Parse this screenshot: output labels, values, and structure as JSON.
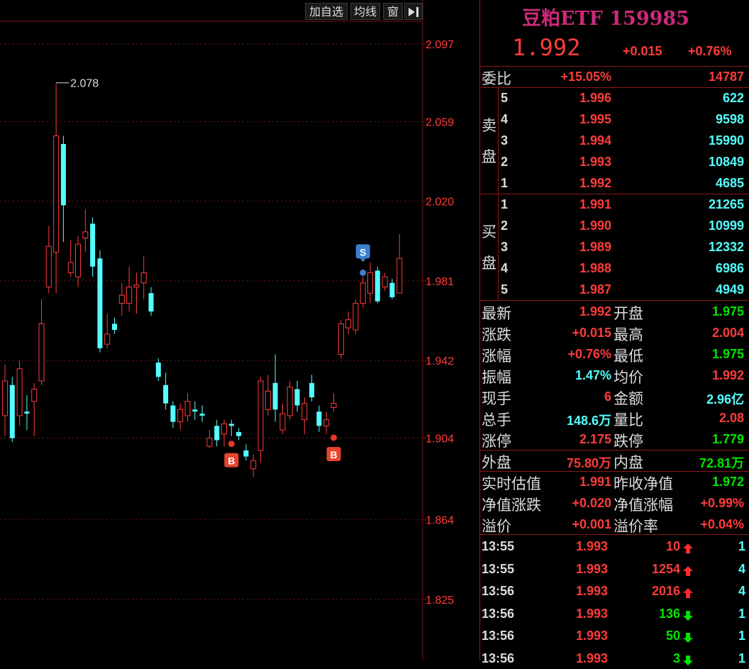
{
  "toolbar": {
    "add_watchlist": "加自选",
    "moving_avg": "均线",
    "window": "窗",
    "expand_icon": "arrow-right-bar-icon"
  },
  "chart_data": {
    "type": "candlestick",
    "title": "",
    "y_ticks": [
      "2.097",
      "2.059",
      "2.020",
      "1.981",
      "1.942",
      "1.904",
      "1.864",
      "1.825"
    ],
    "ylim": [
      1.79,
      2.12
    ],
    "peak_label": "2.078",
    "grid": true,
    "candles": [
      {
        "o": 1.915,
        "c": 1.932,
        "h": 1.94,
        "l": 1.905
      },
      {
        "o": 1.93,
        "c": 1.904,
        "h": 1.934,
        "l": 1.902
      },
      {
        "o": 1.915,
        "c": 1.938,
        "h": 1.942,
        "l": 1.91
      },
      {
        "o": 1.917,
        "c": 1.916,
        "h": 1.925,
        "l": 1.908
      },
      {
        "o": 1.922,
        "c": 1.928,
        "h": 1.931,
        "l": 1.905
      },
      {
        "o": 1.932,
        "c": 1.96,
        "h": 1.972,
        "l": 1.93
      },
      {
        "o": 1.978,
        "c": 1.998,
        "h": 2.008,
        "l": 1.975
      },
      {
        "o": 1.995,
        "c": 2.052,
        "h": 2.078,
        "l": 1.975
      },
      {
        "o": 2.048,
        "c": 2.018,
        "h": 2.052,
        "l": 2.0
      },
      {
        "o": 1.985,
        "c": 1.99,
        "h": 2.001,
        "l": 1.983
      },
      {
        "o": 1.983,
        "c": 1.999,
        "h": 2.003,
        "l": 1.978
      },
      {
        "o": 2.002,
        "c": 2.005,
        "h": 2.016,
        "l": 1.995
      },
      {
        "o": 2.009,
        "c": 1.988,
        "h": 2.012,
        "l": 1.983
      },
      {
        "o": 1.992,
        "c": 1.948,
        "h": 1.996,
        "l": 1.946
      },
      {
        "o": 1.95,
        "c": 1.955,
        "h": 1.965,
        "l": 1.948
      },
      {
        "o": 1.96,
        "c": 1.957,
        "h": 1.963,
        "l": 1.955
      },
      {
        "o": 1.97,
        "c": 1.974,
        "h": 1.98,
        "l": 1.964
      },
      {
        "o": 1.97,
        "c": 1.978,
        "h": 1.988,
        "l": 1.966
      },
      {
        "o": 1.978,
        "c": 1.979,
        "h": 1.985,
        "l": 1.965
      },
      {
        "o": 1.98,
        "c": 1.985,
        "h": 1.993,
        "l": 1.972
      },
      {
        "o": 1.975,
        "c": 1.966,
        "h": 1.978,
        "l": 1.964
      },
      {
        "o": 1.941,
        "c": 1.934,
        "h": 1.943,
        "l": 1.932
      },
      {
        "o": 1.93,
        "c": 1.921,
        "h": 1.936,
        "l": 1.918
      },
      {
        "o": 1.92,
        "c": 1.912,
        "h": 1.922,
        "l": 1.909
      },
      {
        "o": 1.912,
        "c": 1.918,
        "h": 1.921,
        "l": 1.908
      },
      {
        "o": 1.915,
        "c": 1.922,
        "h": 1.926,
        "l": 1.912
      },
      {
        "o": 1.918,
        "c": 1.917,
        "h": 1.922,
        "l": 1.913
      },
      {
        "o": 1.916,
        "c": 1.915,
        "h": 1.92,
        "l": 1.912
      },
      {
        "o": 1.9,
        "c": 1.904,
        "h": 1.908,
        "l": 1.899
      },
      {
        "o": 1.91,
        "c": 1.903,
        "h": 1.913,
        "l": 1.9
      },
      {
        "o": 1.906,
        "c": 1.911,
        "h": 1.913,
        "l": 1.9
      },
      {
        "o": 1.911,
        "c": 1.91,
        "h": 1.913,
        "l": 1.905
      },
      {
        "o": 1.907,
        "c": 1.905,
        "h": 1.909,
        "l": 1.903
      },
      {
        "o": 1.898,
        "c": 1.895,
        "h": 1.901,
        "l": 1.893
      },
      {
        "o": 1.889,
        "c": 1.893,
        "h": 1.896,
        "l": 1.885
      },
      {
        "o": 1.898,
        "c": 1.932,
        "h": 1.934,
        "l": 1.892
      },
      {
        "o": 1.918,
        "c": 1.927,
        "h": 1.935,
        "l": 1.915
      },
      {
        "o": 1.931,
        "c": 1.918,
        "h": 1.945,
        "l": 1.912
      },
      {
        "o": 1.908,
        "c": 1.916,
        "h": 1.921,
        "l": 1.906
      },
      {
        "o": 1.915,
        "c": 1.929,
        "h": 1.932,
        "l": 1.913
      },
      {
        "o": 1.928,
        "c": 1.92,
        "h": 1.932,
        "l": 1.917
      },
      {
        "o": 1.913,
        "c": 1.921,
        "h": 1.924,
        "l": 1.906
      },
      {
        "o": 1.931,
        "c": 1.924,
        "h": 1.935,
        "l": 1.922
      },
      {
        "o": 1.917,
        "c": 1.91,
        "h": 1.92,
        "l": 1.907
      },
      {
        "o": 1.91,
        "c": 1.913,
        "h": 1.917,
        "l": 1.906
      },
      {
        "o": 1.919,
        "c": 1.921,
        "h": 1.926,
        "l": 1.917
      },
      {
        "o": 1.945,
        "c": 1.96,
        "h": 1.962,
        "l": 1.943
      },
      {
        "o": 1.958,
        "c": 1.962,
        "h": 1.966,
        "l": 1.955
      },
      {
        "o": 1.957,
        "c": 1.97,
        "h": 1.972,
        "l": 1.955
      },
      {
        "o": 1.97,
        "c": 1.98,
        "h": 1.983,
        "l": 1.968
      },
      {
        "o": 1.975,
        "c": 1.985,
        "h": 1.99,
        "l": 1.97
      },
      {
        "o": 1.986,
        "c": 1.971,
        "h": 1.988,
        "l": 1.97
      },
      {
        "o": 1.978,
        "c": 1.983,
        "h": 1.985,
        "l": 1.976
      },
      {
        "o": 1.98,
        "c": 1.973,
        "h": 1.982,
        "l": 1.972
      },
      {
        "o": 1.975,
        "c": 1.992,
        "h": 2.004,
        "l": 1.975
      }
    ],
    "signals": [
      {
        "type": "B",
        "index": 31,
        "price": 1.904
      },
      {
        "type": "B",
        "index": 45,
        "price": 1.907
      },
      {
        "type": "S",
        "index": 49,
        "price": 1.985
      }
    ]
  },
  "quote": {
    "name": "豆粕ETF 159985",
    "price": "1.992",
    "change": "+0.015",
    "change_pct": "+0.76%",
    "weibi_label": "委比",
    "weibi_pct": "+15.05%",
    "weibi_diff": "14787",
    "sell_label": [
      "卖",
      "盘"
    ],
    "buy_label": [
      "买",
      "盘"
    ],
    "sells": [
      {
        "level": "5",
        "price": "1.996",
        "vol": "622"
      },
      {
        "level": "4",
        "price": "1.995",
        "vol": "9598"
      },
      {
        "level": "3",
        "price": "1.994",
        "vol": "15990"
      },
      {
        "level": "2",
        "price": "1.993",
        "vol": "10849"
      },
      {
        "level": "1",
        "price": "1.992",
        "vol": "4685"
      }
    ],
    "buys": [
      {
        "level": "1",
        "price": "1.991",
        "vol": "21265"
      },
      {
        "level": "2",
        "price": "1.990",
        "vol": "10999"
      },
      {
        "level": "3",
        "price": "1.989",
        "vol": "12332"
      },
      {
        "level": "4",
        "price": "1.988",
        "vol": "6986"
      },
      {
        "level": "5",
        "price": "1.987",
        "vol": "4949"
      }
    ],
    "stats": [
      {
        "l1": "最新",
        "v1": "1.992",
        "l2": "开盘",
        "v2": "1.975"
      },
      {
        "l1": "涨跌",
        "v1": "+0.015",
        "l2": "最高",
        "v2": "2.004"
      },
      {
        "l1": "涨幅",
        "v1": "+0.76%",
        "l2": "最低",
        "v2": "1.975"
      },
      {
        "l1": "振幅",
        "v1": "1.47%",
        "l2": "均价",
        "v2": "1.992"
      },
      {
        "l1": "现手",
        "v1": "6",
        "l2": "金额",
        "v2": "2.96亿"
      },
      {
        "l1": "总手",
        "v1": "148.6万",
        "l2": "量比",
        "v2": "2.08"
      },
      {
        "l1": "涨停",
        "v1": "2.175",
        "l2": "跌停",
        "v2": "1.779"
      }
    ],
    "outer_label": "外盘",
    "outer_val": "75.80万",
    "inner_label": "内盘",
    "inner_val": "72.81万",
    "nav": [
      {
        "l1": "实时估值",
        "v1": "1.991",
        "l2": "昨收净值",
        "v2": "1.972"
      },
      {
        "l1": "净值涨跌",
        "v1": "+0.020",
        "l2": "净值涨幅",
        "v2": "+0.99%"
      },
      {
        "l1": "溢价",
        "v1": "+0.001",
        "l2": "溢价率",
        "v2": "+0.04%"
      }
    ],
    "ticks": [
      {
        "time": "13:55",
        "price": "1.993",
        "vol": "10",
        "dir": "up",
        "n": "1"
      },
      {
        "time": "13:55",
        "price": "1.993",
        "vol": "1254",
        "dir": "up",
        "n": "4"
      },
      {
        "time": "13:56",
        "price": "1.993",
        "vol": "2016",
        "dir": "up",
        "n": "4"
      },
      {
        "time": "13:56",
        "price": "1.993",
        "vol": "136",
        "dir": "down",
        "n": "1"
      },
      {
        "time": "13:56",
        "price": "1.993",
        "vol": "50",
        "dir": "down",
        "n": "1"
      },
      {
        "time": "13:56",
        "price": "1.993",
        "vol": "3",
        "dir": "down",
        "n": "1"
      }
    ]
  },
  "colors": {
    "up": "#ff3b3b",
    "down": "#54ffff",
    "green": "#00e600",
    "grid": "#7a1515",
    "blue": "#3aa6ff",
    "bg": "#000000",
    "title": "#cc2a7a"
  }
}
